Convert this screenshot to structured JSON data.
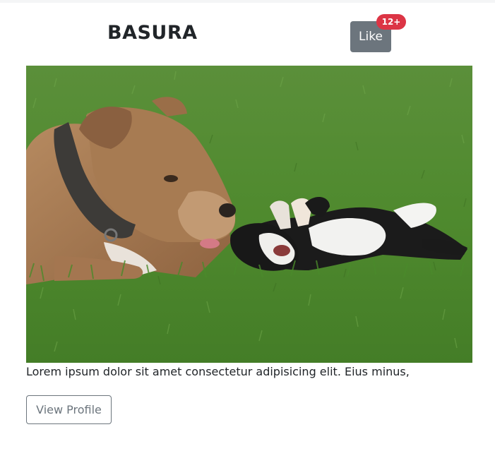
{
  "card": {
    "title": "BASURA",
    "like_label": "Like",
    "like_badge": "12+",
    "image_alt": "Two dogs playing on the grass",
    "text": "Lorem ipsum dolor sit amet consectetur adipisicing elit. Eius minus,",
    "profile_label": "View Profile"
  },
  "colors": {
    "like_button": "#6c757d",
    "badge": "#dc3545",
    "title_text": "#212529",
    "outline_button": "#6c757d"
  }
}
